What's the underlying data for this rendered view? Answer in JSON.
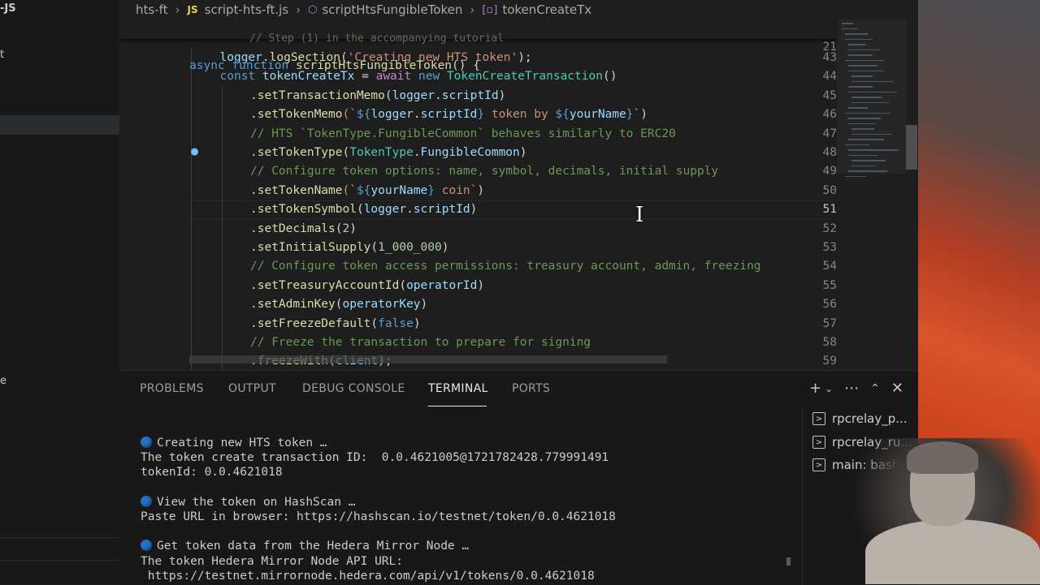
{
  "sidebar": {
    "title_fragment": "-JS",
    "fragment_2": "t",
    "fragment_3": "e"
  },
  "breadcrumb": {
    "folder": "hts-ft",
    "file_badge": "JS",
    "file": "script-hts-ft.js",
    "symbol": "scriptHtsFungibleToken",
    "member": "tokenCreateTx"
  },
  "editor": {
    "active_line": "51",
    "sticky": {
      "num": "21",
      "tokens": [
        {
          "t": "async ",
          "c": "kw"
        },
        {
          "t": "function ",
          "c": "kw"
        },
        {
          "t": "scriptHtsFungibleToken",
          "c": "fn"
        },
        {
          "t": "() {",
          "c": "plain"
        }
      ]
    },
    "ghost_comment": "// Step (1) in the accompanying tutorial",
    "lines": [
      {
        "num": "43",
        "indent": 1,
        "tokens": [
          {
            "t": "logger",
            "c": "var"
          },
          {
            "t": ".",
            "c": "plain"
          },
          {
            "t": "logSection",
            "c": "fn"
          },
          {
            "t": "(",
            "c": "plain"
          },
          {
            "t": "'Creating new HTS token'",
            "c": "str"
          },
          {
            "t": ");",
            "c": "plain"
          }
        ]
      },
      {
        "num": "44",
        "indent": 1,
        "tokens": [
          {
            "t": "const ",
            "c": "kw"
          },
          {
            "t": "tokenCreateTx",
            "c": "var"
          },
          {
            "t": " = ",
            "c": "plain"
          },
          {
            "t": "await ",
            "c": "ctl"
          },
          {
            "t": "new ",
            "c": "kw"
          },
          {
            "t": "TokenCreateTransaction",
            "c": "cls"
          },
          {
            "t": "()",
            "c": "plain"
          }
        ]
      },
      {
        "num": "45",
        "indent": 2,
        "tokens": [
          {
            "t": ".",
            "c": "plain"
          },
          {
            "t": "setTransactionMemo",
            "c": "fn"
          },
          {
            "t": "(",
            "c": "plain"
          },
          {
            "t": "logger",
            "c": "var"
          },
          {
            "t": ".",
            "c": "plain"
          },
          {
            "t": "scriptId",
            "c": "var"
          },
          {
            "t": ")",
            "c": "plain"
          }
        ]
      },
      {
        "num": "46",
        "indent": 2,
        "tokens": [
          {
            "t": ".",
            "c": "plain"
          },
          {
            "t": "setTokenMemo",
            "c": "fn"
          },
          {
            "t": "(`",
            "c": "str"
          },
          {
            "t": "${",
            "c": "kw"
          },
          {
            "t": "logger",
            "c": "var"
          },
          {
            "t": ".",
            "c": "plain"
          },
          {
            "t": "scriptId",
            "c": "var"
          },
          {
            "t": "}",
            "c": "kw"
          },
          {
            "t": " token by ",
            "c": "str"
          },
          {
            "t": "${",
            "c": "kw"
          },
          {
            "t": "yourName",
            "c": "var"
          },
          {
            "t": "}",
            "c": "kw"
          },
          {
            "t": "`",
            "c": "str"
          },
          {
            "t": ")",
            "c": "plain"
          }
        ]
      },
      {
        "num": "47",
        "indent": 2,
        "tokens": [
          {
            "t": "// HTS `TokenType.FungibleCommon` behaves similarly to ERC20",
            "c": "com"
          }
        ]
      },
      {
        "num": "48",
        "indent": 2,
        "tokens": [
          {
            "t": ".",
            "c": "plain"
          },
          {
            "t": "setTokenType",
            "c": "fn"
          },
          {
            "t": "(",
            "c": "plain"
          },
          {
            "t": "TokenType",
            "c": "cls"
          },
          {
            "t": ".",
            "c": "plain"
          },
          {
            "t": "FungibleCommon",
            "c": "var"
          },
          {
            "t": ")",
            "c": "plain"
          }
        ]
      },
      {
        "num": "49",
        "indent": 2,
        "tokens": [
          {
            "t": "// Configure token options: name, symbol, decimals, initial supply",
            "c": "com"
          }
        ]
      },
      {
        "num": "50",
        "indent": 2,
        "tokens": [
          {
            "t": ".",
            "c": "plain"
          },
          {
            "t": "setTokenName",
            "c": "fn"
          },
          {
            "t": "(`",
            "c": "str"
          },
          {
            "t": "${",
            "c": "kw"
          },
          {
            "t": "yourName",
            "c": "var"
          },
          {
            "t": "}",
            "c": "kw"
          },
          {
            "t": " coin`",
            "c": "str"
          },
          {
            "t": ")",
            "c": "plain"
          }
        ]
      },
      {
        "num": "51",
        "indent": 2,
        "tokens": [
          {
            "t": ".",
            "c": "plain"
          },
          {
            "t": "setTokenSymbol",
            "c": "fn"
          },
          {
            "t": "(",
            "c": "plain"
          },
          {
            "t": "logger",
            "c": "var"
          },
          {
            "t": ".",
            "c": "plain"
          },
          {
            "t": "scriptId",
            "c": "var"
          },
          {
            "t": ")",
            "c": "plain"
          }
        ]
      },
      {
        "num": "52",
        "indent": 2,
        "tokens": [
          {
            "t": ".",
            "c": "plain"
          },
          {
            "t": "setDecimals",
            "c": "fn"
          },
          {
            "t": "(",
            "c": "plain"
          },
          {
            "t": "2",
            "c": "num"
          },
          {
            "t": ")",
            "c": "plain"
          }
        ]
      },
      {
        "num": "53",
        "indent": 2,
        "tokens": [
          {
            "t": ".",
            "c": "plain"
          },
          {
            "t": "setInitialSupply",
            "c": "fn"
          },
          {
            "t": "(",
            "c": "plain"
          },
          {
            "t": "1_000_000",
            "c": "num"
          },
          {
            "t": ")",
            "c": "plain"
          }
        ]
      },
      {
        "num": "54",
        "indent": 2,
        "tokens": [
          {
            "t": "// Configure token access permissions: treasury account, admin, freezing",
            "c": "com"
          }
        ]
      },
      {
        "num": "55",
        "indent": 2,
        "tokens": [
          {
            "t": ".",
            "c": "plain"
          },
          {
            "t": "setTreasuryAccountId",
            "c": "fn"
          },
          {
            "t": "(",
            "c": "plain"
          },
          {
            "t": "operatorId",
            "c": "var"
          },
          {
            "t": ")",
            "c": "plain"
          }
        ]
      },
      {
        "num": "56",
        "indent": 2,
        "tokens": [
          {
            "t": ".",
            "c": "plain"
          },
          {
            "t": "setAdminKey",
            "c": "fn"
          },
          {
            "t": "(",
            "c": "plain"
          },
          {
            "t": "operatorKey",
            "c": "var"
          },
          {
            "t": ")",
            "c": "plain"
          }
        ]
      },
      {
        "num": "57",
        "indent": 2,
        "tokens": [
          {
            "t": ".",
            "c": "plain"
          },
          {
            "t": "setFreezeDefault",
            "c": "fn"
          },
          {
            "t": "(",
            "c": "plain"
          },
          {
            "t": "false",
            "c": "kw"
          },
          {
            "t": ")",
            "c": "plain"
          }
        ]
      },
      {
        "num": "58",
        "indent": 2,
        "tokens": [
          {
            "t": "// Freeze the transaction to prepare for signing",
            "c": "com"
          }
        ]
      },
      {
        "num": "59",
        "indent": 2,
        "tokens": [
          {
            "t": ".",
            "c": "plain"
          },
          {
            "t": "freezeWith",
            "c": "fn"
          },
          {
            "t": "(",
            "c": "plain"
          },
          {
            "t": "client",
            "c": "var"
          },
          {
            "t": ");",
            "c": "plain"
          }
        ]
      }
    ]
  },
  "panel": {
    "tabs": [
      "PROBLEMS",
      "OUTPUT",
      "DEBUG CONSOLE",
      "TERMINAL",
      "PORTS"
    ],
    "active_tab": "TERMINAL",
    "terminal_lines": [
      {
        "dot": true,
        "text": "Creating new HTS token …"
      },
      {
        "dot": false,
        "text": "The token create transaction ID:  0.0.4621005@1721782428.779991491"
      },
      {
        "dot": false,
        "text": "tokenId: 0.0.4621018"
      },
      {
        "dot": false,
        "text": ""
      },
      {
        "dot": true,
        "text": "View the token on HashScan …"
      },
      {
        "dot": false,
        "text": "Paste URL in browser: https://hashscan.io/testnet/token/0.0.4621018"
      },
      {
        "dot": false,
        "text": ""
      },
      {
        "dot": true,
        "text": "Get token data from the Hedera Mirror Node …"
      },
      {
        "dot": false,
        "text": "The token Hedera Mirror Node API URL:"
      },
      {
        "dot": false,
        "text": " https://testnet.mirrornode.hedera.com/api/v1/tokens/0.0.4621018"
      }
    ],
    "terminals": [
      "rpcrelay_p...",
      "rpcrelay_ru...",
      "main: bash"
    ]
  },
  "colors": {
    "editor_bg": "#1e1e1e",
    "panel_bg": "#181818",
    "terminal_dot": "#2472c8"
  }
}
